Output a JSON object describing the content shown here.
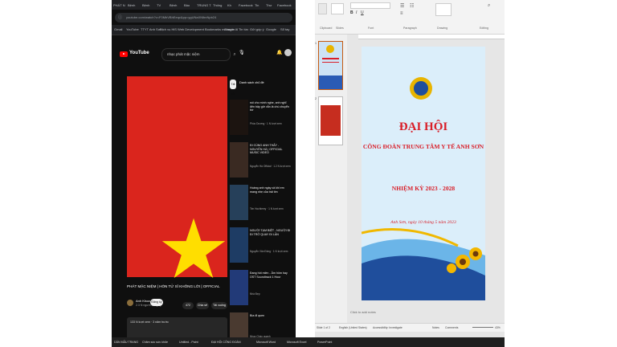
{
  "browser": {
    "tabs": [
      "PHÁT N",
      "Bệnh",
      "Bệnh",
      "TV",
      "Bệnh",
      "Bảo",
      "TRUNG TÂ",
      "Thống",
      "Kh",
      "Facebook",
      "Tin",
      "Thư",
      "Facebook"
    ],
    "url": "youtube.com/watch?v=F0MhVBhEeqc&pp=ygUNaXNlbnNpb24",
    "bookmarks": [
      "Gmail",
      "YouTube",
      "TTYT Anh Sơn",
      "Dịch vụ HiS",
      "Web Development",
      "Bookmarks manager",
      "Claude AI",
      "Tin tức",
      "Gửi góp ý",
      "Google",
      "Sổ tay"
    ]
  },
  "youtube": {
    "logo_text": "YouTube",
    "search_value": "nhạc phát mặc niệm",
    "video_title": "PHÁT MẶC NIỆM | HÒN TỬ SĨ KHÔNG LỜI | OFFICIAL",
    "channel": "Anh Khoa",
    "channel_sub": "2.3 N người đăng ký",
    "subscribe_label": "Đăng ký",
    "likes": "472",
    "share_label": "Chia sẻ",
    "download_label": "Tải xuống",
    "description": "133 N lượt xem · 3 năm trước",
    "chip_label": "Tất cả",
    "chip_text": "Danh sách chủ đề",
    "recommendations": [
      {
        "title": "nói cho mình nghe, anh nghĩ đến bây giờ vẫn là chú chuyển bờ",
        "meta": "Phúc Dương · 1 N lượt xem"
      },
      {
        "title": "ĐI CÙNG ANH THẤY - NGUYỄN HÀ | OFFICIAL MUSIC VIDEO",
        "meta": "Nguyễn Hà Official · 1.2 N lượt xem"
      },
      {
        "title": "Hoàng anh ngày cả khi em mang nhẹ của trái tim",
        "meta": "Tim Hochiemy · 1 N lượt xem"
      },
      {
        "title": "NGƯỜI TẠM BIỆT - NGƯỜI ĐI ĐI TRỞ QUAY ĐI LẦN",
        "meta": "Nguyễn Văn Đông · 1 N lượt xem"
      },
      {
        "title": "Đang hót miền - Âm hôm hay OST Soundtrack 1 Hour",
        "meta": "Nhà Đẹp"
      },
      {
        "title": "Bìa đi quen",
        "meta": "Nhạc Chào quanh"
      }
    ]
  },
  "powerpoint": {
    "ribbon_groups": [
      "Clipboard",
      "Slides",
      "Font",
      "Paragraph",
      "Drawing",
      "Editing"
    ],
    "slide_numbers": [
      "1",
      "2"
    ],
    "slide": {
      "line1": "ĐẠI HỘI",
      "line2": "CÔNG ĐOÀN TRUNG TÂM Y TẾ ANH SƠN",
      "line3": "NHIỆM KỲ 2023 - 2028",
      "line4": "Anh Sơn, ngày 10 tháng 5 năm 2023"
    },
    "notes_placeholder": "Click to add notes",
    "status": [
      "Slide 1 of 2",
      "English (United States)",
      "Accessibility: Investigate",
      "Notes",
      "Comments"
    ],
    "zoom": "43%"
  },
  "taskbar": {
    "items": [
      "DẢN MẪU TRANG",
      "Chăm sóc sức khỏe",
      "Untitled - Paint",
      "ĐẠI HỘI CÔNG ĐOÀN",
      "Microsoft Word",
      "Microsoft Excel",
      "PowerPoint"
    ]
  },
  "colors": {
    "flag_red": "#da251d",
    "flag_star": "#ffde00",
    "slide_title": "#d91e28",
    "ppt_accent": "#c55a11"
  }
}
